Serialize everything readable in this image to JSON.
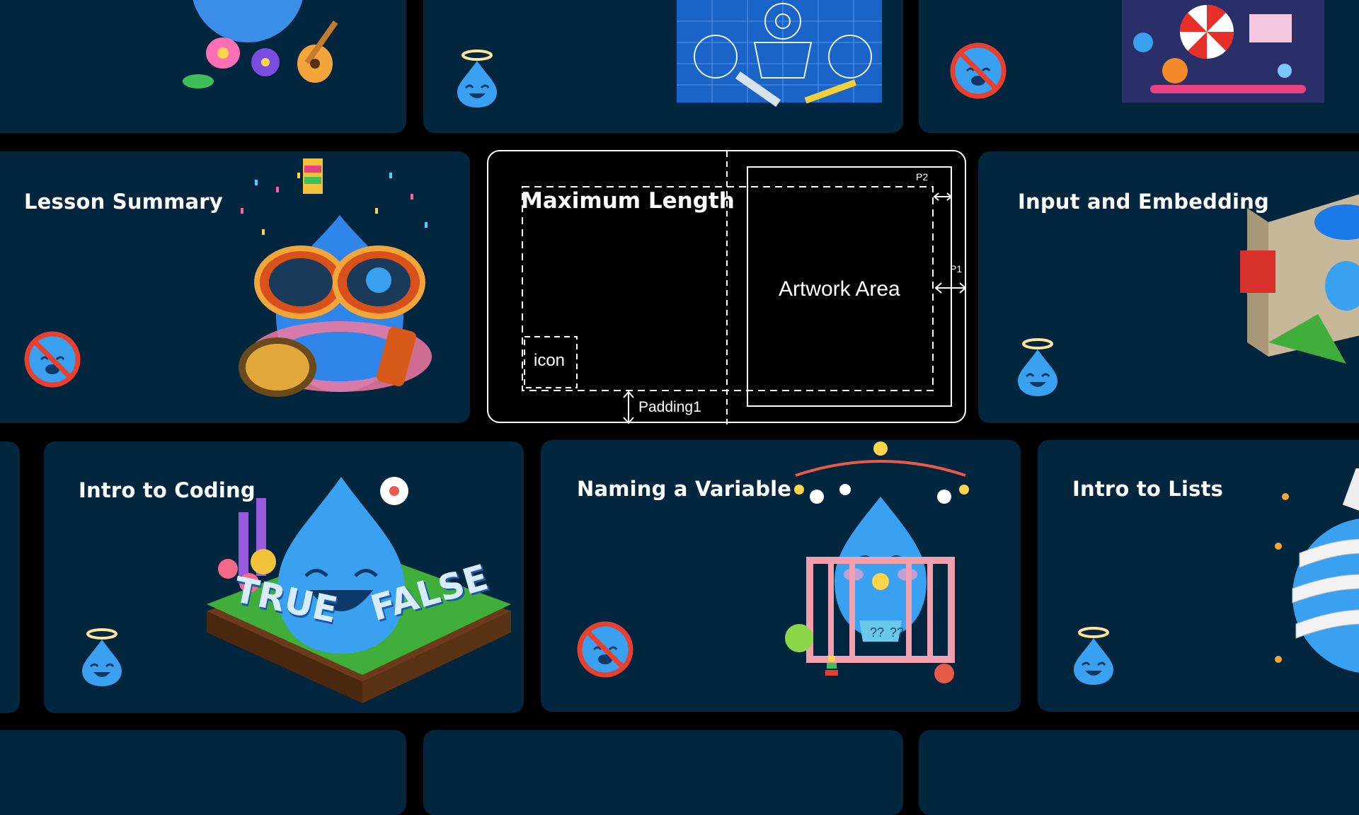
{
  "cards": {
    "lesson_summary": {
      "title": "Lesson Summary",
      "status": "not-allowed"
    },
    "input_embedding": {
      "title": "Input and Embedding",
      "status": "angel"
    },
    "intro_coding": {
      "title": "Intro to Coding",
      "status": "angel",
      "art_words": [
        "TRUE",
        "FALSE"
      ]
    },
    "naming_variable": {
      "title": "Naming a Variable",
      "status": "not-allowed",
      "art_words": [
        "??",
        "??"
      ]
    },
    "intro_lists": {
      "title": "Intro to Lists",
      "status": "angel"
    },
    "top_left": {
      "status": "none"
    },
    "top_mid": {
      "status": "angel"
    },
    "top_right": {
      "status": "not-allowed"
    }
  },
  "spec": {
    "maximum_length": "Maximum Length",
    "artwork_area": "Artwork Area",
    "icon": "icon",
    "padding1": "Padding1",
    "p1": "P1",
    "p2": "P2"
  },
  "colors": {
    "background": "#000000",
    "card": "#03263f",
    "drop_blue": "#3aa0f0",
    "forbidden_red": "#e8402f"
  },
  "icons": [
    "angel-drop-icon",
    "not-allowed-drop-icon",
    "double-arrow-icon"
  ]
}
